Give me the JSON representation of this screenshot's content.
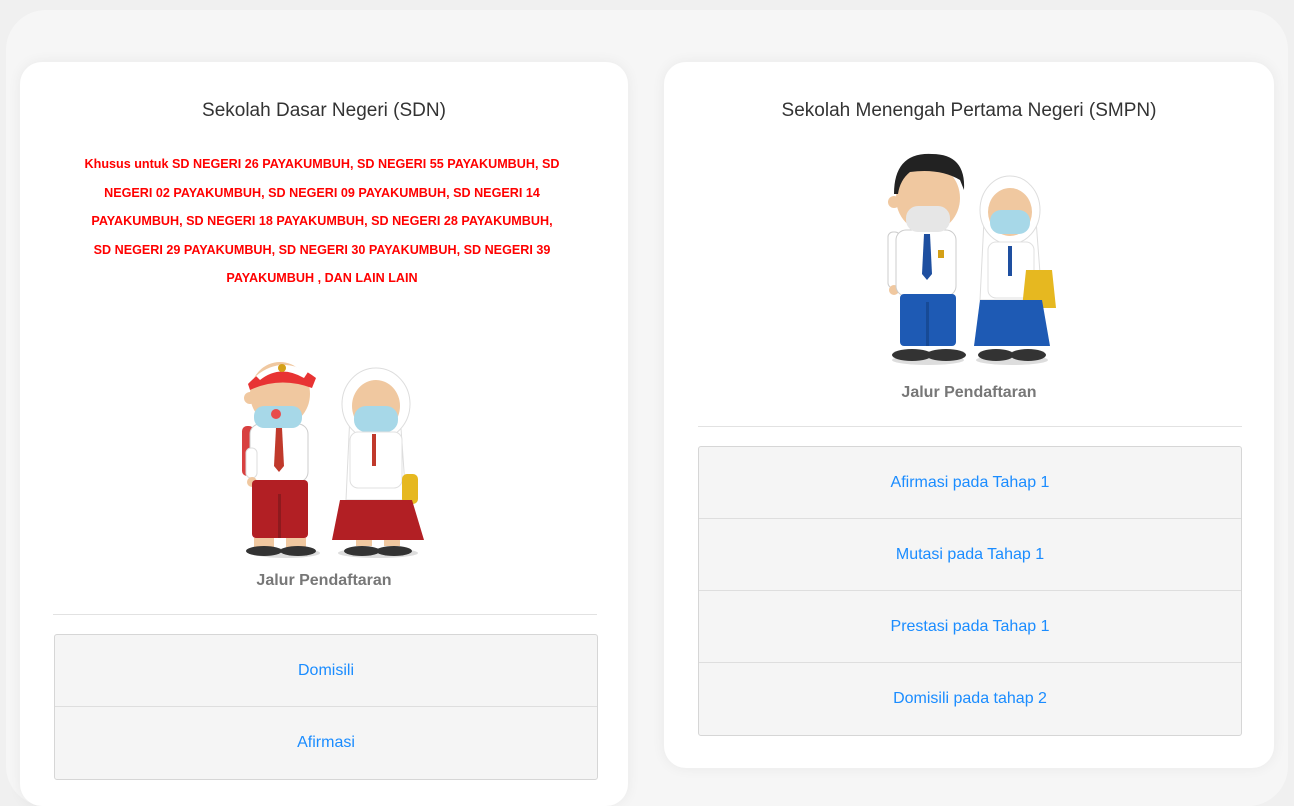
{
  "sdn": {
    "title": "Sekolah Dasar Negeri (SDN)",
    "notice": "Khusus untuk SD NEGERI 26 PAYAKUMBUH, SD NEGERI 55 PAYAKUMBUH, SD NEGERI 02 PAYAKUMBUH, SD NEGERI 09 PAYAKUMBUH, SD NEGERI 14 PAYAKUMBUH, SD NEGERI 18 PAYAKUMBUH, SD NEGERI 28 PAYAKUMBUH, SD NEGERI 29 PAYAKUMBUH, SD NEGERI 30 PAYAKUMBUH, SD NEGERI 39 PAYAKUMBUH , DAN LAIN LAIN",
    "section_label": "Jalur Pendaftaran",
    "buttons": [
      "Domisili",
      "Afirmasi"
    ]
  },
  "smpn": {
    "title": "Sekolah Menengah Pertama Negeri (SMPN)",
    "section_label": "Jalur Pendaftaran",
    "buttons": [
      "Afirmasi pada Tahap 1",
      "Mutasi pada Tahap 1",
      "Prestasi pada Tahap 1",
      "Domisili pada tahap 2"
    ]
  },
  "colors": {
    "notice": "#ff0000",
    "link": "#1a8cff",
    "sdn_uniform_bottom": "#b21f24",
    "smpn_uniform_bottom": "#1e5ab4"
  }
}
